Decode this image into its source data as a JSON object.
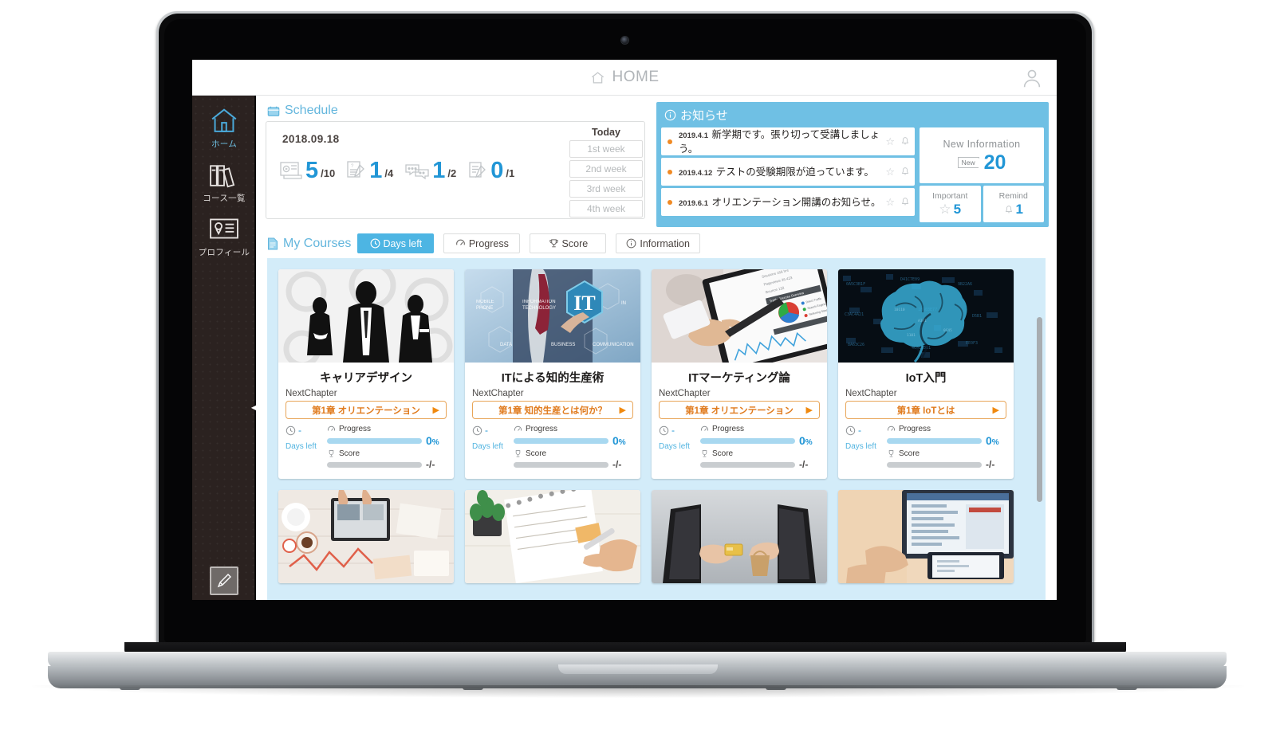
{
  "appbar": {
    "title": "HOME",
    "home_icon": "home-icon",
    "user_icon": "user-avatar-icon"
  },
  "sidebar": {
    "items": [
      {
        "label": "ホーム",
        "icon": "home-icon",
        "active": true
      },
      {
        "label": "コース一覧",
        "icon": "books-icon",
        "active": false
      },
      {
        "label": "プロフィール",
        "icon": "id-card-icon",
        "active": false
      }
    ],
    "bottom_icon": "pencil-icon",
    "collapse_icon": "chevron-left-icon"
  },
  "schedule": {
    "section_title": "Schedule",
    "section_icon": "calendar-icon",
    "date": "2018.09.18",
    "stats": [
      {
        "icon": "video-icon",
        "value": "5",
        "denominator": "/10"
      },
      {
        "icon": "quiz-icon",
        "value": "1",
        "denominator": "/4"
      },
      {
        "icon": "chat-icon",
        "value": "1",
        "denominator": "/2"
      },
      {
        "icon": "report-icon",
        "value": "0",
        "denominator": "/1"
      }
    ],
    "today_label": "Today",
    "weeks": [
      "1st week",
      "2nd week",
      "3rd week",
      "4th week"
    ]
  },
  "notifications": {
    "section_title": "お知らせ",
    "section_icon": "info-icon",
    "items": [
      {
        "date": "2019.4.1",
        "title": "新学期です。張り切って受講しましょう。"
      },
      {
        "date": "2019.4.12",
        "title": "テストの受験期限が迫っています。"
      },
      {
        "date": "2019.6.1",
        "title": "オリエンテーション開講のお知らせ。"
      }
    ],
    "new_information": {
      "label": "New Information",
      "tag": "New",
      "count": "20"
    },
    "important": {
      "label": "Important",
      "icon": "star-icon",
      "count": "5"
    },
    "remind": {
      "label": "Remind",
      "icon": "bell-icon",
      "count": "1"
    }
  },
  "my_courses": {
    "title": "My Courses",
    "title_icon": "document-icon",
    "tabs": [
      {
        "label": "Days left",
        "icon": "clock-icon",
        "active": true
      },
      {
        "label": "Progress",
        "icon": "gauge-icon",
        "active": false
      },
      {
        "label": "Score",
        "icon": "trophy-icon",
        "active": false
      },
      {
        "label": "Information",
        "icon": "info-icon",
        "active": false
      }
    ],
    "next_chapter_label": "NextChapter",
    "progress_label": "Progress",
    "score_label": "Score",
    "days_left_label": "Days left",
    "days_left_value": "-",
    "cards": [
      {
        "title": "キャリアデザイン",
        "chapter": "第1章 オリエンテーション",
        "progress": "0",
        "progress_unit": "%",
        "score": "-/-",
        "image": "business-silhouettes-gears"
      },
      {
        "title": "ITによる知的生産術",
        "chapter": "第1章 知的生産とは何か？",
        "progress": "0",
        "progress_unit": "%",
        "score": "-/-",
        "image": "it-hexagon-businessman"
      },
      {
        "title": "ITマーケティング論",
        "chapter": "第1章 オリエンテーション",
        "progress": "0",
        "progress_unit": "%",
        "score": "-/-",
        "image": "tablet-analytics-stylus"
      },
      {
        "title": "IoT入門",
        "chapter": "第1章 IoTとは",
        "progress": "0",
        "progress_unit": "%",
        "score": "-/-",
        "image": "digital-brain"
      }
    ],
    "row2_images": [
      "desk-tablet-flatlay",
      "notebook-plant-sketch",
      "monitor-handshake-shopping",
      "laptop-tablet-desk"
    ]
  },
  "colors": {
    "accent_blue": "#2196d6",
    "panel_blue": "#6fc0e4",
    "bg_light_blue": "#d3ecf9",
    "orange": "#e07b1e",
    "sidebar_dark": "#2b2220"
  }
}
